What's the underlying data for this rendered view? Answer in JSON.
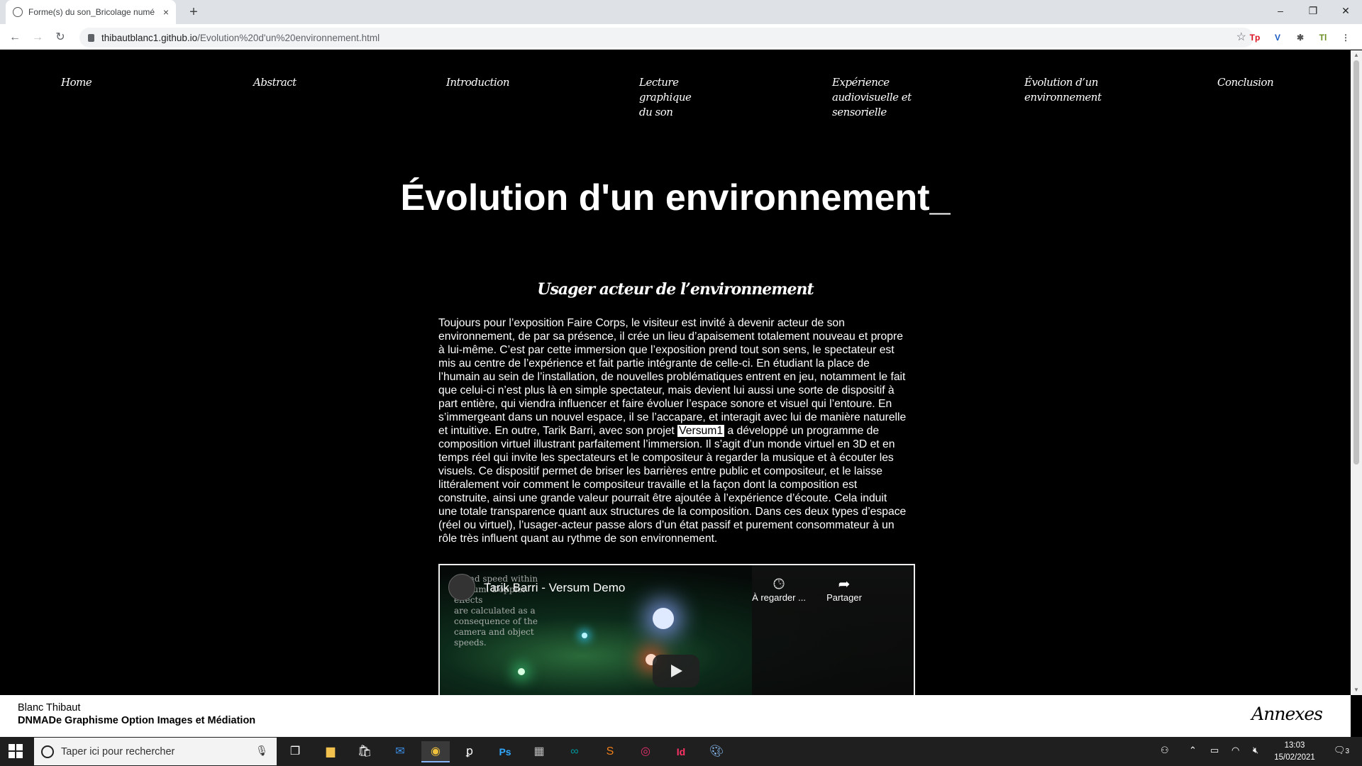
{
  "browser": {
    "tab_title": "Forme(s) du son_Bricolage numé",
    "tab_close": "×",
    "new_tab": "+",
    "url_host": "thibautblanc1.github.io",
    "url_path": "/Evolution%20d'un%20environnement.html",
    "window_controls": [
      "–",
      "❐",
      "✕"
    ],
    "extensions": [
      "Tp",
      "V",
      "✱",
      "Tl",
      "⋮"
    ]
  },
  "nav": [
    {
      "label": "Home"
    },
    {
      "label": "Abstract"
    },
    {
      "label": "Introduction"
    },
    {
      "label": "Lecture\ngraphique\ndu son"
    },
    {
      "label": "Expérience\naudiovisuelle et\nsensorielle"
    },
    {
      "label": "Évolution d’un\nenvironnement"
    },
    {
      "label": "Conclusion"
    }
  ],
  "page": {
    "title": "Évolution d'un environnement_",
    "subtitle": "Usager acteur de l’environnement",
    "body_before": "Toujours pour l’exposition Faire Corps, le visiteur est invité à devenir acteur de son environnement, de par sa présence, il crée un lieu d’apaisement totalement nouveau et propre à lui-même. C’est par cette immersion que l’exposition prend tout son sens, le spectateur est mis au centre de l’expérience et fait partie intégrante de celle-ci. En étudiant la place de l’humain au sein de l’installation, de nouvelles problématiques entrent en jeu, notamment le fait que celui-ci n’est plus là en simple spectateur, mais devient lui aussi une sorte de dispositif à part entière, qui viendra influencer et faire évoluer l’espace sonore et visuel qui l’entoure. En s’immergeant dans un nouvel espace, il se l’accapare, et interagit avec lui de manière naturelle et intuitive. En outre, Tarik Barri, avec son projet ",
    "body_highlight": "Versum1",
    "body_after": " a développé un programme de composition virtuel illustrant parfaitement l’immersion. Il s’agit d’un monde virtuel en 3D et en temps réel qui invite les spectateurs et le compositeur à regarder la musique et à écouter les visuels. Ce dispositif permet de briser les barrières entre public et compositeur, et le laisse littéralement voir comment le compositeur travaille et la façon dont la composition est construite, ainsi une grande valeur pourrait être ajoutée à l’expérience d’écoute. Cela induit une totale transparence quant aux structures de la composition. Dans ces deux types d’espace (réel ou virtuel), l’usager-acteur passe alors d’un état passif et purement consommateur à un rôle très influent quant au rythme de son environnement."
  },
  "video": {
    "title": "Tarik Barri - Versum Demo",
    "overlay_text": "sound speed within\nVersum. Doppler effects\nare calculated as a\nconsequence of the\ncamera and object\nspeeds.",
    "watch_later": "À regarder ...",
    "share": "Partager"
  },
  "footer": {
    "name": "Blanc Thibaut",
    "degree": "DNMADe Graphisme Option Images et Médiation",
    "annexes": "Annexes"
  },
  "taskbar": {
    "search_placeholder": "Taper ici pour rechercher",
    "time": "13:03",
    "date": "15/02/2021",
    "notification_count": "3"
  }
}
